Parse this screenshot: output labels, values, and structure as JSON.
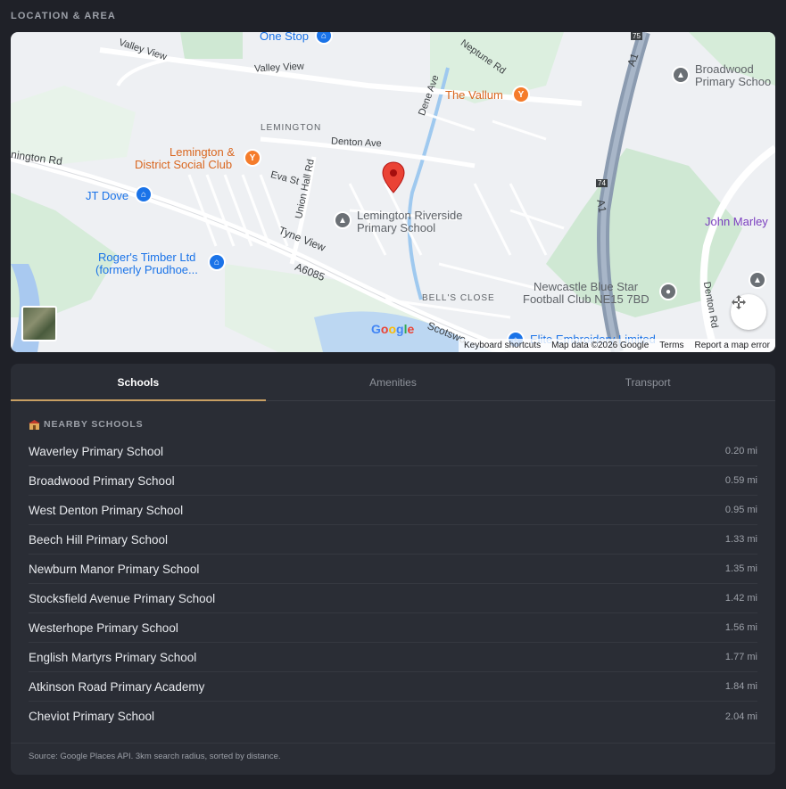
{
  "section_title": "LOCATION & AREA",
  "map": {
    "labels": {
      "one_stop": "One Stop",
      "valley_view_1": "Valley View",
      "valley_view_2": "Valley View",
      "neptune_rd": "Neptune Rd",
      "dene_ave": "Dene Ave",
      "the_vallum": "The Vallum",
      "broadwood_1": "Broadwood",
      "broadwood_2": "Primary Schoo",
      "lemington": "LEMINGTON",
      "denton_ave": "Denton Ave",
      "lemington_social_1": "Lemington &",
      "lemington_social_2": "District Social Club",
      "lemington_rd": "nington Rd",
      "eva_st": "Eva St",
      "union_hall_rd": "Union Hall Rd",
      "jt_dove": "JT Dove",
      "riverside_1": "Lemington Riverside",
      "riverside_2": "Primary School",
      "john_marley": "John Marley",
      "tyne_view": "Tyne View",
      "rogers_1": "Roger's Timber Ltd",
      "rogers_2": "(formerly Prudhoe...",
      "a6085": "A6085",
      "bells_close": "BELL'S CLOSE",
      "newcastle_blue_star_1": "Newcastle Blue Star",
      "newcastle_blue_star_2": "Football Club NE15 7BD",
      "denton_rd": "Denton Rd",
      "a1": "A1",
      "a1_2": "A1",
      "scotswood": "Scotswo",
      "elite": "Elite Embroidery Limited",
      "road_74": "74",
      "road_75": "75"
    },
    "footer": {
      "shortcuts": "Keyboard shortcuts",
      "map_data": "Map data ©2026 Google",
      "terms": "Terms",
      "report": "Report a map error"
    },
    "google_logo": "Google"
  },
  "tabs": [
    {
      "label": "Schools",
      "active": true
    },
    {
      "label": "Amenities",
      "active": false
    },
    {
      "label": "Transport",
      "active": false
    }
  ],
  "schools": {
    "heading": "NEARBY SCHOOLS",
    "icon": "school-icon",
    "items": [
      {
        "name": "Waverley Primary School",
        "distance": "0.20 mi"
      },
      {
        "name": "Broadwood Primary School",
        "distance": "0.59 mi"
      },
      {
        "name": "West Denton Primary School",
        "distance": "0.95 mi"
      },
      {
        "name": "Beech Hill Primary School",
        "distance": "1.33 mi"
      },
      {
        "name": "Newburn Manor Primary School",
        "distance": "1.35 mi"
      },
      {
        "name": "Stocksfield Avenue Primary School",
        "distance": "1.42 mi"
      },
      {
        "name": "Westerhope Primary School",
        "distance": "1.56 mi"
      },
      {
        "name": "English Martyrs Primary School",
        "distance": "1.77 mi"
      },
      {
        "name": "Atkinson Road Primary Academy",
        "distance": "1.84 mi"
      },
      {
        "name": "Cheviot Primary School",
        "distance": "2.04 mi"
      }
    ],
    "source_note": "Source: Google Places API. 3km search radius, sorted by distance."
  },
  "colors": {
    "accent": "#c9a063",
    "background": "#1f2128",
    "panel": "#2a2d35",
    "map_pin": "#ea4335"
  }
}
